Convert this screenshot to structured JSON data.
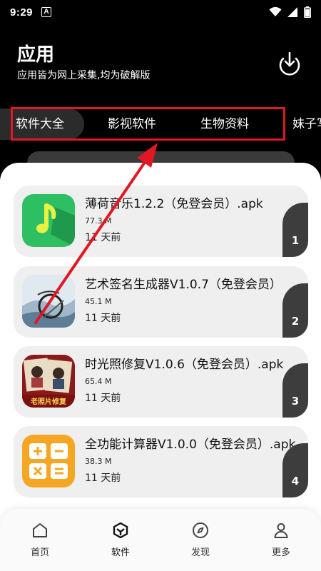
{
  "status_bar": {
    "time": "9:29",
    "notification_glyph": "A"
  },
  "header": {
    "title": "应用",
    "subtitle": "应用皆为网上采集,均为破解版"
  },
  "tabs": [
    {
      "label": "软件大全",
      "active": true
    },
    {
      "label": "影视软件",
      "active": false
    },
    {
      "label": "生物资料",
      "active": false
    },
    {
      "label": "妹子写",
      "active": false
    }
  ],
  "apps": [
    {
      "name": "薄荷音乐1.2.2（免登会员）.apk",
      "size": "77.3 M",
      "time": "11 天前",
      "rank": "1",
      "icon": "music-note-icon"
    },
    {
      "name": "艺术签名生成器V1.0.7（免登会员）",
      "size": "45.1 M",
      "time": "11 天前",
      "rank": "2",
      "icon": "signature-art-icon"
    },
    {
      "name": "时光照修复V1.0.6（免登会员）.apk",
      "size": "65.4 M",
      "time": "11 天前",
      "rank": "3",
      "icon": "photo-restore-icon",
      "icon_text": "老照片修复"
    },
    {
      "name": "全功能计算器V1.0.0（免登会员）.apk",
      "size": "38.3 M",
      "time": "11 天前",
      "rank": "4",
      "icon": "calculator-icon"
    }
  ],
  "bottom_nav": [
    {
      "label": "首页",
      "icon": "home-icon",
      "active": false
    },
    {
      "label": "软件",
      "icon": "software-icon",
      "active": true
    },
    {
      "label": "发现",
      "icon": "compass-icon",
      "active": false
    },
    {
      "label": "更多",
      "icon": "user-icon",
      "active": false
    }
  ],
  "colors": {
    "background": "#000000",
    "annotation_red": "#e01823",
    "music_icon_green": "#2fbf63",
    "calculator_orange": "#f5a623",
    "badge_dark": "#3d3d3d"
  }
}
